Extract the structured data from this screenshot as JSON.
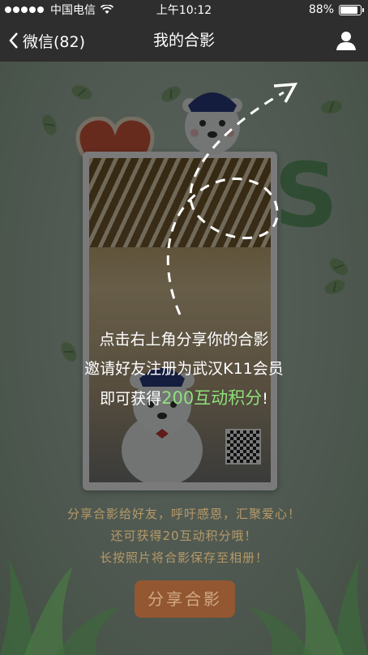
{
  "status_bar": {
    "carrier": "中国电信",
    "time": "上午10:12",
    "battery": "88%",
    "battery_level": 0.88
  },
  "nav": {
    "back_label": "微信(82)",
    "title": "我的合影"
  },
  "overlay_text": {
    "line1": "点击右上角分享你的合影",
    "line2": "邀请好友注册为武汉K11会员",
    "line3_prefix": "即可获得",
    "line3_highlight": "200互动积分",
    "line3_suffix": "!"
  },
  "bottom_text": {
    "line1": "分享合影给好友，呼吁感恩，汇聚爱心！",
    "line2": "还可获得20互动积分哦！",
    "line3": "长按照片将合影保存至相册！"
  },
  "share_button_label": "分享合影",
  "icons": {
    "back": "chevron-left-icon",
    "profile": "person-icon",
    "wifi": "wifi-icon",
    "battery": "battery-icon"
  },
  "colors": {
    "nav_bg": "#2e2e2e",
    "highlight_green": "#8fe07a",
    "share_button": "#a0582c",
    "bottom_text": "#c9a46c"
  }
}
